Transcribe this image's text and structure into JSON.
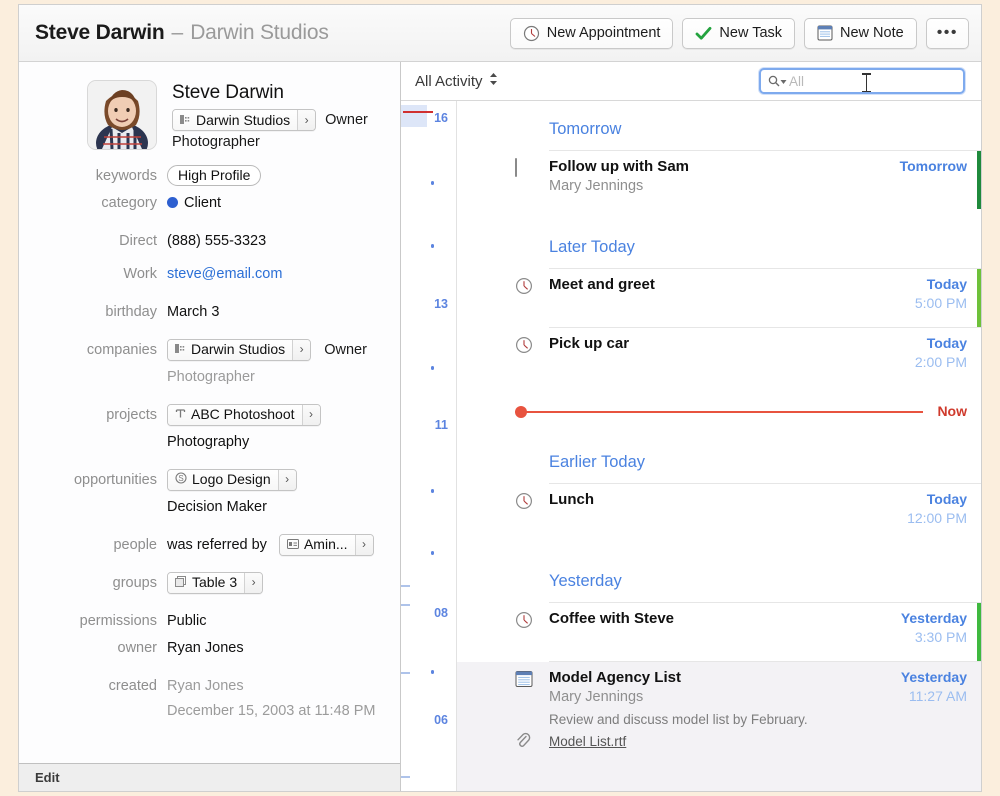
{
  "titlebar": {
    "name": "Steve Darwin",
    "dash": "–",
    "org": "Darwin Studios",
    "buttons": [
      {
        "label": "New Appointment",
        "icon": "clock-icon"
      },
      {
        "label": "New Task",
        "icon": "check-icon"
      },
      {
        "label": "New Note",
        "icon": "note-icon"
      }
    ],
    "more_label": "•••"
  },
  "profile": {
    "name": "Steve Darwin",
    "company_chip": "Darwin Studios",
    "company_role": "Owner",
    "job_title": "Photographer"
  },
  "fields": {
    "keywords_label": "keywords",
    "keywords_value": "High Profile",
    "category_label": "category",
    "category_value": "Client",
    "category_color": "#2d5fd0",
    "direct_label": "Direct",
    "direct_value": "(888) 555-3323",
    "work_label": "Work",
    "work_value": "steve@email.com",
    "birthday_label": "birthday",
    "birthday_value": "March  3",
    "companies_label": "companies",
    "companies_chip": "Darwin Studios",
    "companies_role": "Owner",
    "companies_sub": "Photographer",
    "projects_label": "projects",
    "projects_chip": "ABC Photoshoot",
    "projects_sub": "Photography",
    "opportunities_label": "opportunities",
    "opportunities_chip": "Logo Design",
    "opportunities_sub": "Decision Maker",
    "people_label": "people",
    "people_prefix": "was referred by",
    "people_chip": "Amin...",
    "groups_label": "groups",
    "groups_chip": "Table 3",
    "permissions_label": "permissions",
    "permissions_value": "Public",
    "owner_label": "owner",
    "owner_value": "Ryan Jones",
    "created_label": "created",
    "created_by": "Ryan Jones",
    "created_at": "December 15, 2003 at 11:48 PM"
  },
  "edit_bar": {
    "label": "Edit"
  },
  "activity": {
    "filter_label": "All Activity",
    "search_prefix": "Q",
    "search_placeholder": "All",
    "gutter_hours": [
      "16",
      "13",
      "11",
      "08",
      "06"
    ],
    "now_label": "Now",
    "sections": [
      {
        "label": "Tomorrow"
      },
      {
        "label": "Later Today"
      },
      {
        "label": "Earlier Today"
      },
      {
        "label": "Yesterday"
      }
    ],
    "items": [
      {
        "type": "task",
        "icon": "checkbox-icon",
        "title": "Follow up with Sam",
        "subtitle": "Mary Jennings",
        "when": "Tomorrow",
        "time": "",
        "accent": "#1f8a3c"
      },
      {
        "type": "appointment",
        "icon": "clock-icon",
        "title": "Meet and greet",
        "subtitle": "",
        "when": "Today",
        "time": "5:00 PM",
        "accent": "#6ec13a"
      },
      {
        "type": "appointment",
        "icon": "clock-icon",
        "title": "Pick up car",
        "subtitle": "",
        "when": "Today",
        "time": "2:00 PM",
        "accent": ""
      },
      {
        "type": "appointment",
        "icon": "clock-icon",
        "title": "Lunch",
        "subtitle": "",
        "when": "Today",
        "time": "12:00 PM",
        "accent": ""
      },
      {
        "type": "appointment",
        "icon": "clock-icon",
        "title": "Coffee with Steve",
        "subtitle": "",
        "when": "Yesterday",
        "time": "3:30 PM",
        "accent": "#3fb93f"
      },
      {
        "type": "note",
        "icon": "note-icon",
        "title": "Model Agency List",
        "subtitle": "Mary Jennings",
        "body": "Review and discuss model list by February.",
        "attachment": "Model List.rtf",
        "when": "Yesterday",
        "time": "11:27 AM",
        "accent": "",
        "selected": true
      }
    ]
  }
}
